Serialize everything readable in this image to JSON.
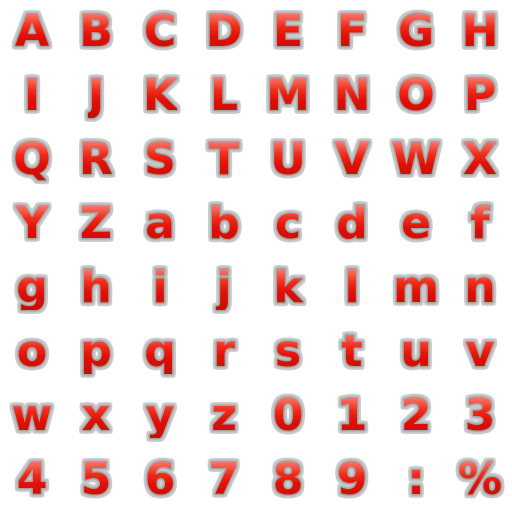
{
  "sprite_sheet": {
    "style": {
      "fill_color": "#e81a0c",
      "highlight_color": "#ff8a80",
      "outline_color": "#a8a8a8"
    },
    "glyphs": [
      "A",
      "B",
      "C",
      "D",
      "E",
      "F",
      "G",
      "H",
      "I",
      "J",
      "K",
      "L",
      "M",
      "N",
      "O",
      "P",
      "Q",
      "R",
      "S",
      "T",
      "U",
      "V",
      "W",
      "X",
      "Y",
      "Z",
      "a",
      "b",
      "c",
      "d",
      "e",
      "f",
      "g",
      "h",
      "i",
      "j",
      "k",
      "l",
      "m",
      "n",
      "o",
      "p",
      "q",
      "r",
      "s",
      "t",
      "u",
      "v",
      "w",
      "x",
      "y",
      "z",
      "0",
      "1",
      "2",
      "3",
      "4",
      "5",
      "6",
      "7",
      "8",
      "9",
      ":",
      "%"
    ]
  }
}
